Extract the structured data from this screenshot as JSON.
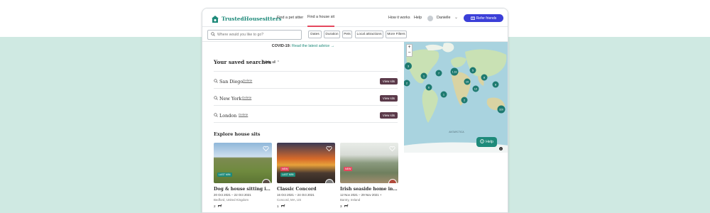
{
  "header": {
    "logo_text": "TrustedHousesitters",
    "nav": [
      {
        "label": "Find a pet sitter"
      },
      {
        "label": "Find a house sit"
      },
      {
        "label": "How it works"
      },
      {
        "label": "Help"
      }
    ],
    "user_name": "Danielle",
    "refer_label": "Refer friends"
  },
  "search": {
    "placeholder": "Where would you like to go?",
    "filters": [
      "Dates",
      "Duration",
      "Pets",
      "Local attractions",
      "More Filters"
    ]
  },
  "covid": {
    "prefix": "COVID-19:",
    "link": "Read the latest advice →"
  },
  "saved": {
    "title": "Your saved searches",
    "hide_label": "Hide all",
    "delete_label": "Delete",
    "view_label": "View sits",
    "items": [
      {
        "query": "San Diego"
      },
      {
        "query": "New York"
      },
      {
        "query": "London"
      }
    ]
  },
  "explore": {
    "title": "Explore house sits",
    "cards": [
      {
        "title": "Dog & house sitting in the c...",
        "dates": "20 Oct 2021 – 22 Oct 2021",
        "location": "Bedford, United Kingdom",
        "pets": "2",
        "tag": "LAST MIN",
        "tag2": ""
      },
      {
        "title": "Classic Concord",
        "dates": "16 Oct 2021 – 24 Oct 2021",
        "location": "Concord, MA, US",
        "pets": "1",
        "tag": "LAST MIN",
        "tag2": "NEW"
      },
      {
        "title": "Irish seaside home in the la...",
        "dates": "12 Nov 2021 – 29 Nov 2021 +",
        "location": "Bantry, Ireland",
        "pets": "3",
        "tag": "",
        "tag2": "NEW"
      }
    ]
  },
  "map": {
    "zoom_in": "+",
    "zoom_out": "−",
    "antarctica_label": "ANTARCTICA",
    "help_label": "Help",
    "markers": [
      "3",
      "2",
      "1",
      "7",
      "1.1k",
      "5",
      "8",
      "6",
      "10",
      "12",
      "1",
      "2",
      "320",
      "8"
    ]
  },
  "colors": {
    "brand": "#1e8a7a",
    "refer_button": "#3b3fd8",
    "view_button": "#5b3a4a",
    "active_tab": "#e5475d",
    "background_mint": "#cfe9e2"
  }
}
